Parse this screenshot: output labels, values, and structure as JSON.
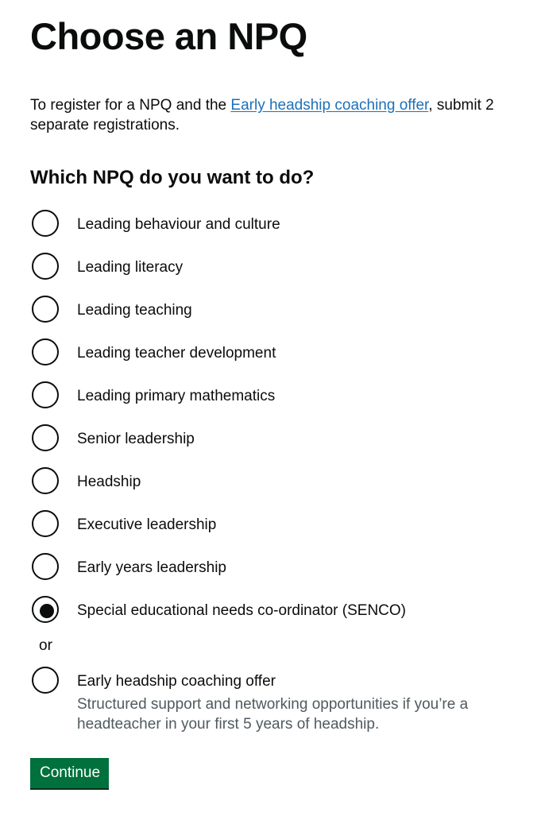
{
  "page_title": "Choose an NPQ",
  "intro": {
    "before_link": "To register for a NPQ and the ",
    "link_text": "Early headship coaching offer",
    "after_link": ", submit 2 separate registrations."
  },
  "question": "Which NPQ do you want to do?",
  "options": [
    {
      "label": "Leading behaviour and culture",
      "selected": false
    },
    {
      "label": "Leading literacy",
      "selected": false
    },
    {
      "label": "Leading teaching",
      "selected": false
    },
    {
      "label": "Leading teacher development",
      "selected": false
    },
    {
      "label": "Leading primary mathematics",
      "selected": false
    },
    {
      "label": "Senior leadership",
      "selected": false
    },
    {
      "label": "Headship",
      "selected": false
    },
    {
      "label": "Executive leadership",
      "selected": false
    },
    {
      "label": "Early years leadership",
      "selected": false
    },
    {
      "label": "Special educational needs co-ordinator (SENCO)",
      "selected": true
    }
  ],
  "or_divider": "or",
  "coaching_option": {
    "label": "Early headship coaching offer",
    "hint": "Structured support and networking opportunities if you’re a headteacher in your first 5 years of headship.",
    "selected": false
  },
  "continue_label": "Continue",
  "colors": {
    "link": "#1d70b8",
    "button": "#00703c",
    "text": "#0b0c0c",
    "hint": "#505a5f"
  }
}
